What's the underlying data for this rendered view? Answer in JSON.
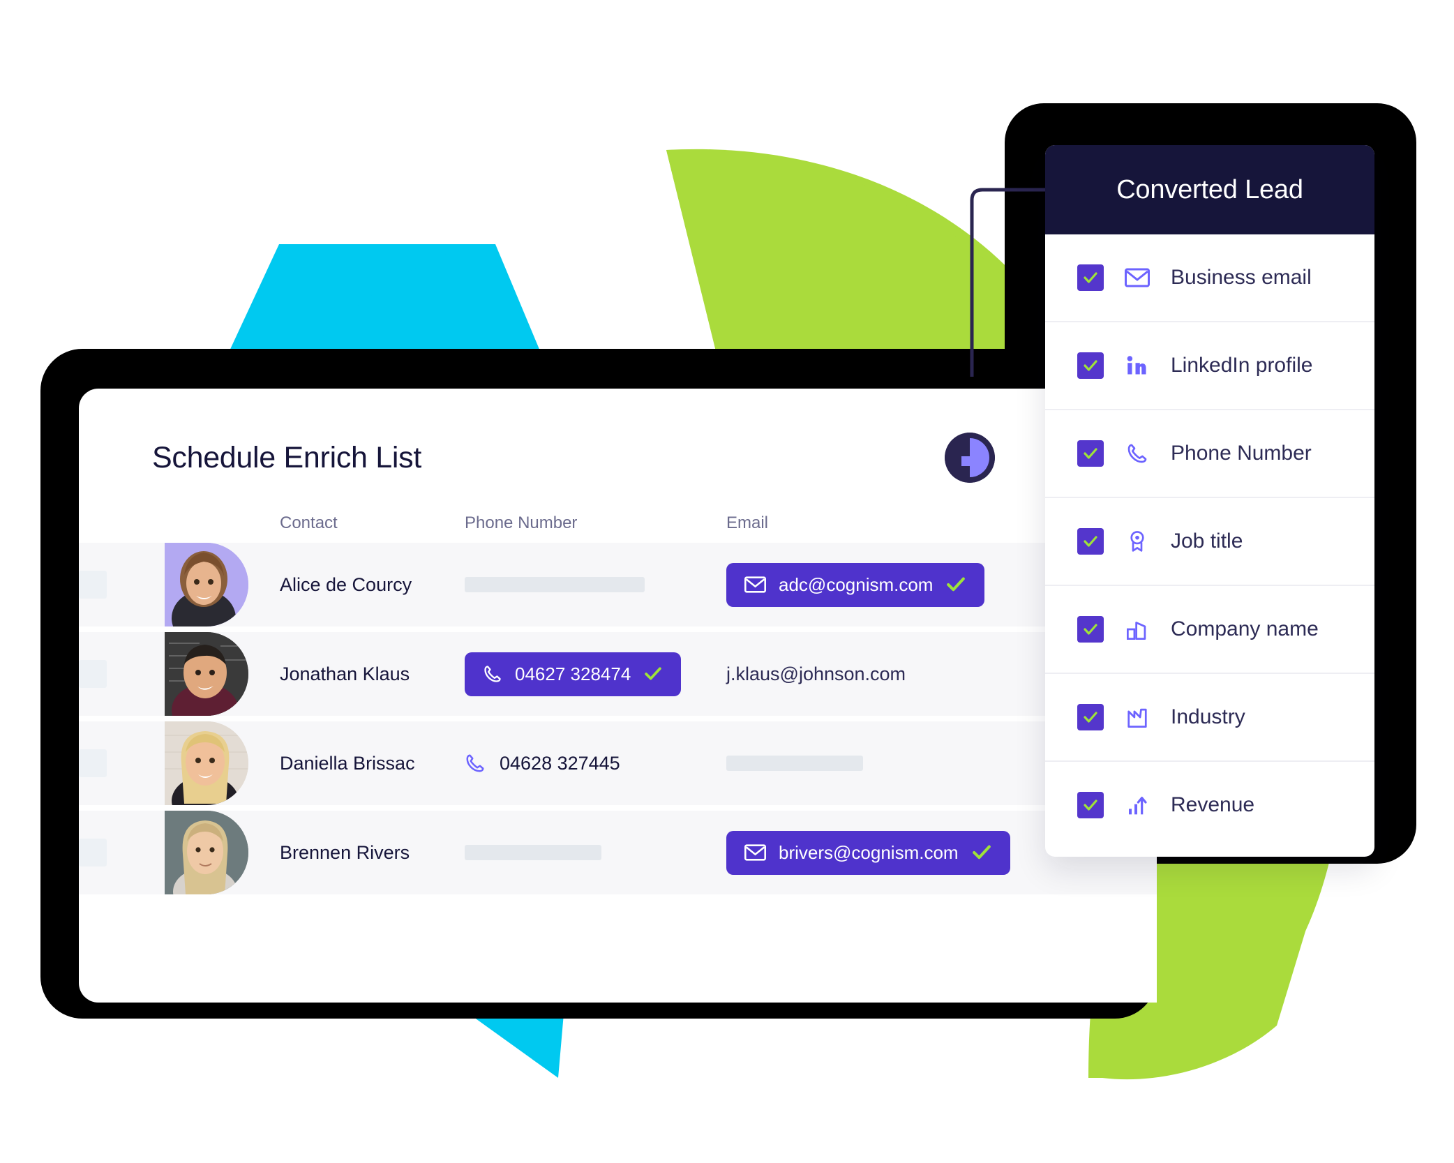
{
  "colors": {
    "brand_purple": "#4f33cc",
    "check_purple": "#5436cc",
    "icon_periwinkle": "#6c63ff",
    "accent_green": "#9fe339",
    "shape_green": "#aadb3c",
    "shape_cyan": "#00c9f0",
    "dark_navy": "#16153a",
    "row_bg": "#f7f7f9",
    "placeholder_gray": "#e4e8ed",
    "checkbox_gray": "#edf1f5",
    "header_text": "#6b6b8d"
  },
  "card": {
    "title": "Schedule Enrich List"
  },
  "table": {
    "columns": [
      "Contact",
      "Phone Number",
      "Email"
    ],
    "rows": [
      {
        "name": "Alice de Courcy",
        "phone": {
          "kind": "placeholder",
          "value": ""
        },
        "email": {
          "kind": "pill",
          "value": "adc@cognism.com",
          "verified": true
        },
        "avatar_bg": "#b3a9f2",
        "avatar_name": "avatar-alice-de-courcy"
      },
      {
        "name": "Jonathan Klaus",
        "phone": {
          "kind": "pill",
          "value": "04627 328474",
          "verified": true
        },
        "email": {
          "kind": "text",
          "value": "j.klaus@johnson.com"
        },
        "avatar_bg": "#3c3c3c",
        "avatar_name": "avatar-jonathan-klaus"
      },
      {
        "name": "Daniella Brissac",
        "phone": {
          "kind": "icon-text",
          "value": "04628 327445"
        },
        "email": {
          "kind": "placeholder",
          "value": ""
        },
        "avatar_bg": "#dfd8d0",
        "avatar_name": "avatar-daniella-brissac"
      },
      {
        "name": "Brennen Rivers",
        "phone": {
          "kind": "placeholder",
          "value": ""
        },
        "email": {
          "kind": "pill",
          "value": "brivers@cognism.com",
          "verified": true
        },
        "avatar_bg": "#6d7b7d",
        "avatar_name": "avatar-brennen-rivers"
      }
    ]
  },
  "lead_panel": {
    "title": "Converted Lead",
    "items": [
      {
        "label": "Business email",
        "icon": "envelope-icon",
        "checked": true
      },
      {
        "label": "LinkedIn profile",
        "icon": "linkedin-icon",
        "checked": true
      },
      {
        "label": "Phone Number",
        "icon": "phone-icon",
        "checked": true
      },
      {
        "label": "Job title",
        "icon": "award-icon",
        "checked": true
      },
      {
        "label": "Company name",
        "icon": "building-icon",
        "checked": true
      },
      {
        "label": "Industry",
        "icon": "factory-icon",
        "checked": true
      },
      {
        "label": "Revenue",
        "icon": "chart-up-icon",
        "checked": true
      }
    ]
  }
}
